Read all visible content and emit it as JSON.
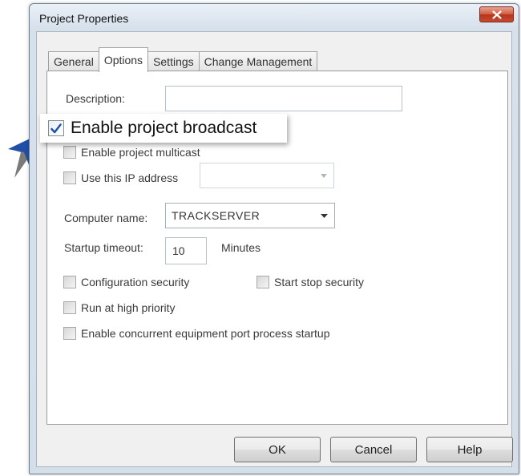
{
  "window": {
    "title": "Project Properties"
  },
  "tabs": [
    {
      "label": "General",
      "active": false
    },
    {
      "label": "Options",
      "active": true
    },
    {
      "label": "Settings",
      "active": false
    },
    {
      "label": "Change Management",
      "active": false
    }
  ],
  "options": {
    "description_label": "Description:",
    "description_value": "",
    "enable_broadcast": {
      "label": "Enable project broadcast",
      "checked": true
    },
    "enable_multicast": {
      "label": "Enable project multicast",
      "checked": false
    },
    "use_ip": {
      "label": "Use this IP address",
      "checked": false,
      "value": ""
    },
    "computer_name_label": "Computer name:",
    "computer_name_value": "TRACKSERVER",
    "startup_timeout_label": "Startup timeout:",
    "startup_timeout_value": "10",
    "startup_timeout_unit": "Minutes",
    "configuration_security": {
      "label": "Configuration security",
      "checked": false
    },
    "start_stop_security": {
      "label": "Start stop security",
      "checked": false
    },
    "run_high_priority": {
      "label": "Run at high priority",
      "checked": false
    },
    "concurrent_startup": {
      "label": "Enable concurrent equipment port process startup",
      "checked": false
    }
  },
  "buttons": {
    "ok": "OK",
    "cancel": "Cancel",
    "help": "Help"
  },
  "colors": {
    "accent": "#1f4fa8",
    "close_button": "#c74a2e"
  }
}
